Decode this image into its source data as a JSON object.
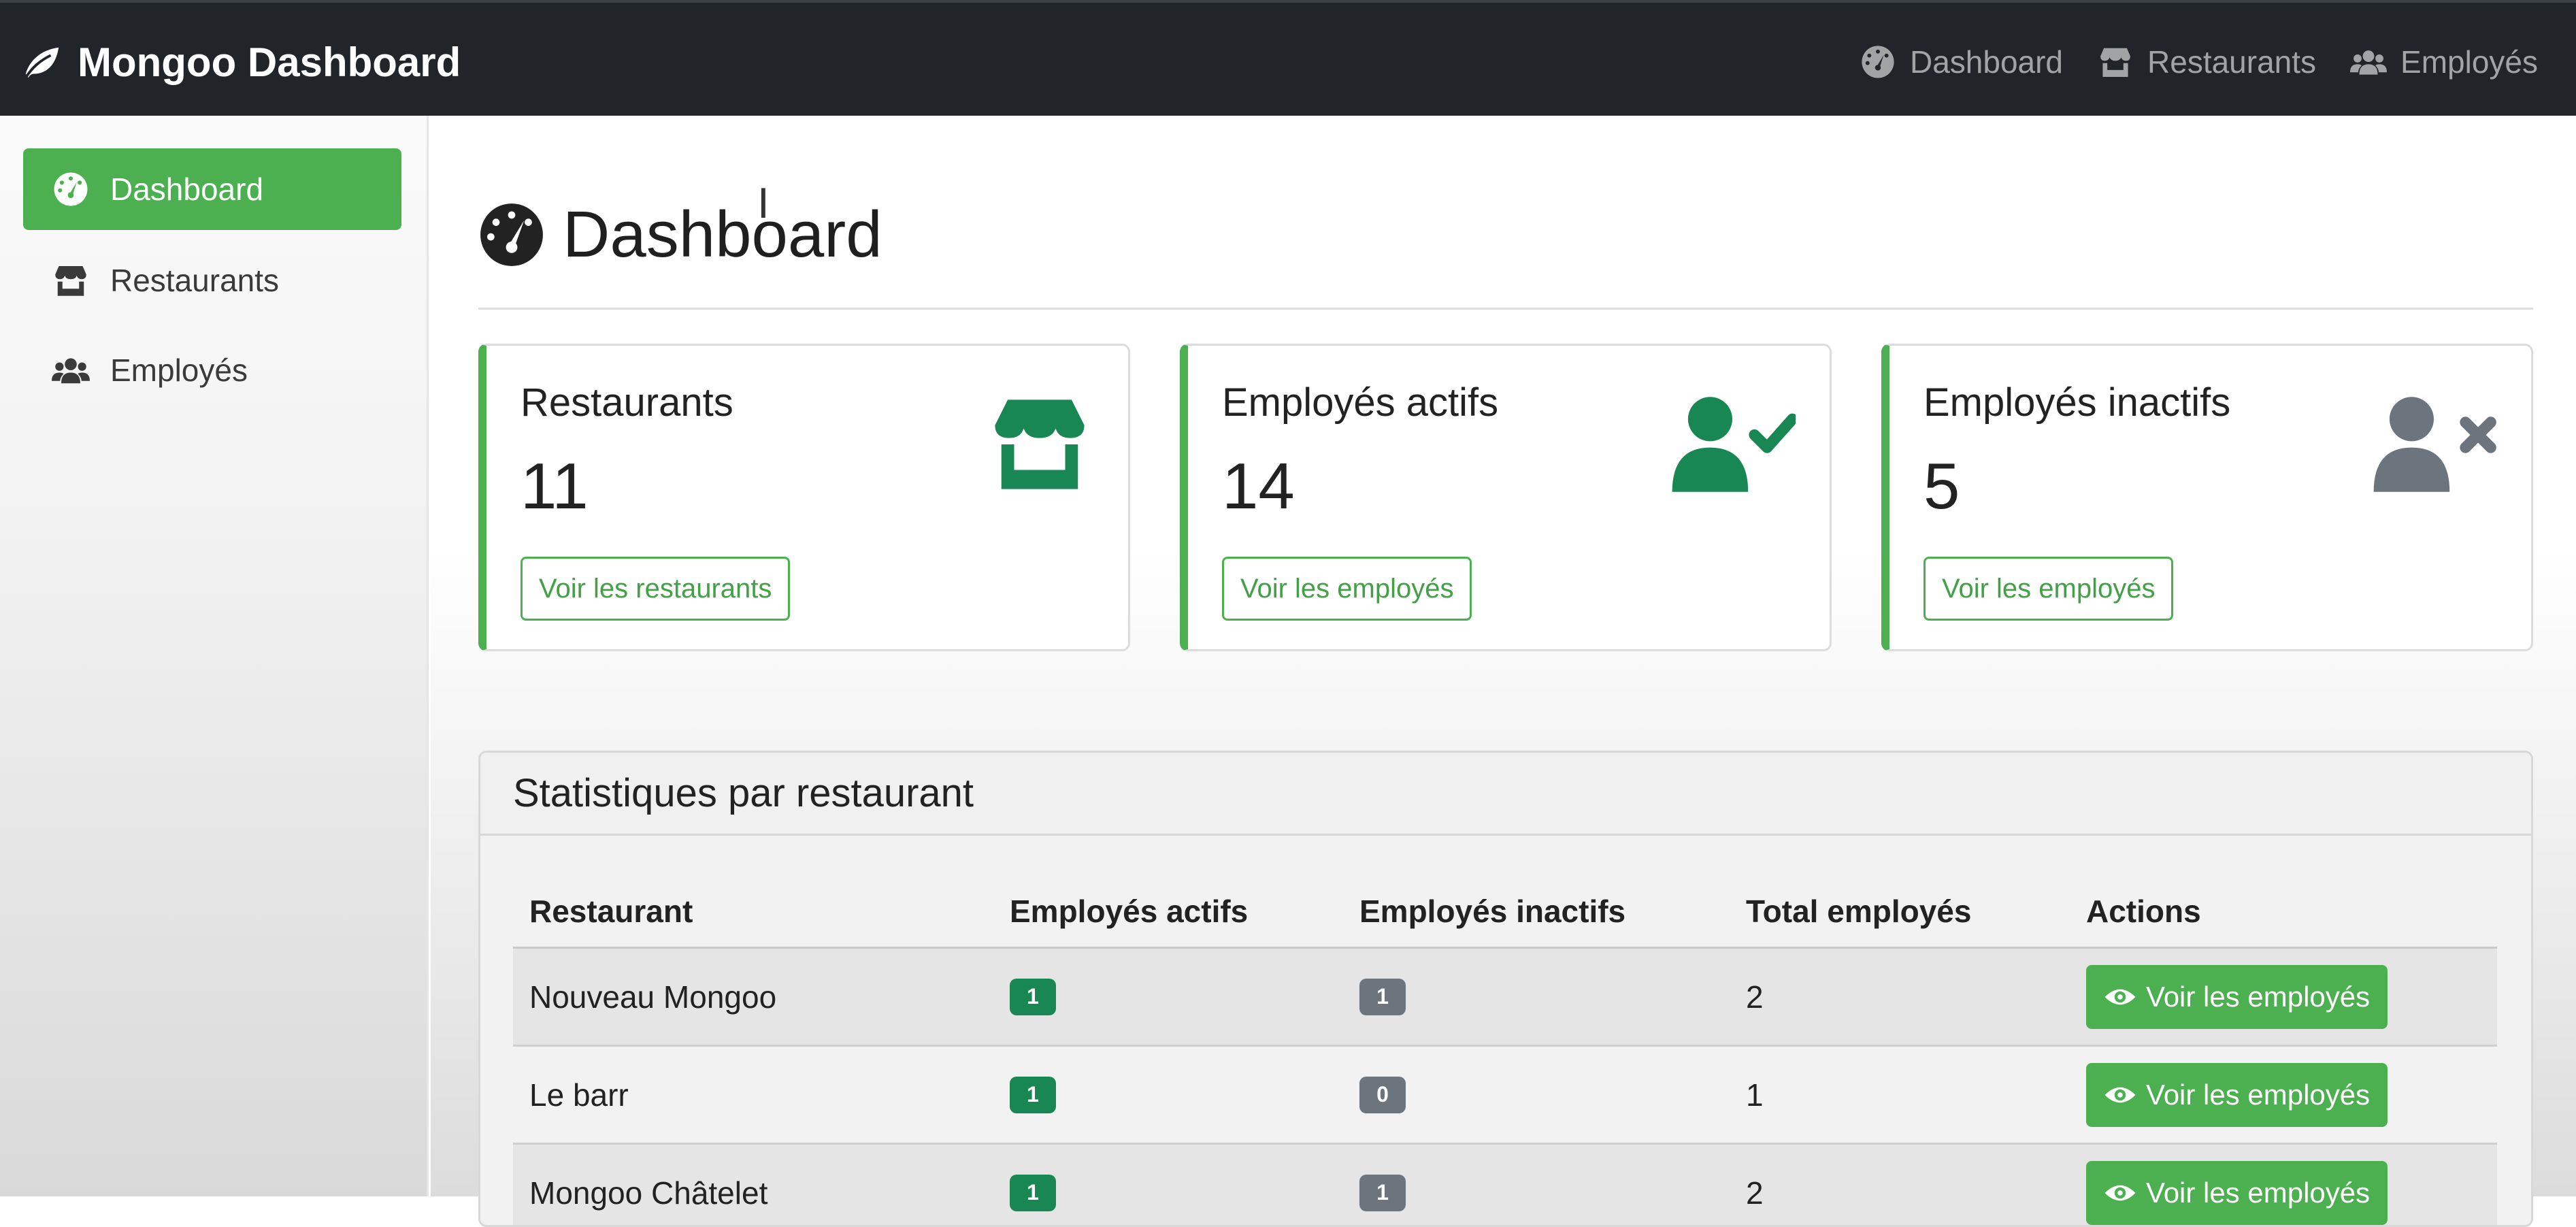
{
  "navbar": {
    "brand": "Mongoo Dashboard",
    "links": [
      {
        "label": "Dashboard",
        "icon": "gauge-icon"
      },
      {
        "label": "Restaurants",
        "icon": "store-icon"
      },
      {
        "label": "Employés",
        "icon": "users-icon"
      }
    ]
  },
  "sidebar": {
    "items": [
      {
        "label": "Dashboard",
        "icon": "gauge-icon",
        "active": true
      },
      {
        "label": "Restaurants",
        "icon": "store-icon",
        "active": false
      },
      {
        "label": "Employés",
        "icon": "users-icon",
        "active": false
      }
    ]
  },
  "main": {
    "title": "Dashboard",
    "cards": [
      {
        "title": "Restaurants",
        "value": "11",
        "button": "Voir les restaurants",
        "icon": "store-icon",
        "icon_color": "#198754"
      },
      {
        "title": "Employés actifs",
        "value": "14",
        "button": "Voir les employés",
        "icon": "user-check-icon",
        "icon_color": "#198754"
      },
      {
        "title": "Employés inactifs",
        "value": "5",
        "button": "Voir les employés",
        "icon": "user-x-icon",
        "icon_color": "#6c757d"
      }
    ],
    "stats": {
      "title": "Statistiques par restaurant",
      "headers": [
        "Restaurant",
        "Employés actifs",
        "Employés inactifs",
        "Total employés",
        "Actions"
      ],
      "rows": [
        {
          "name": "Nouveau Mongoo",
          "active": "1",
          "inactive": "1",
          "total": "2",
          "action": "Voir les employés"
        },
        {
          "name": "Le barr",
          "active": "1",
          "inactive": "0",
          "total": "1",
          "action": "Voir les employés"
        },
        {
          "name": "Mongoo Châtelet",
          "active": "1",
          "inactive": "1",
          "total": "2",
          "action": "Voir les employés"
        }
      ]
    }
  },
  "colors": {
    "navbar": "#212529",
    "accent": "#4caf50",
    "badge_green": "#198754",
    "badge_gray": "#6c757d"
  }
}
